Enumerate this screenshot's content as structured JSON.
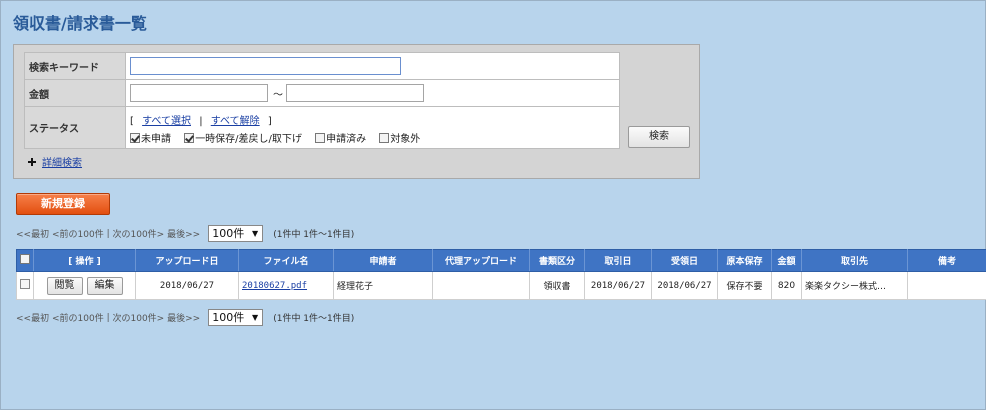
{
  "page": {
    "title": "領収書/請求書一覧"
  },
  "search": {
    "keyword_label": "検索キーワード",
    "keyword_value": "",
    "amount_label": "金額",
    "amount_from": "",
    "amount_to": "",
    "amount_separator": "～",
    "status_label": "ステータス",
    "bracket_open": "[",
    "select_all": "すべて選択",
    "link_sep": "|",
    "deselect_all": "すべて解除",
    "bracket_close": "]",
    "statuses": [
      {
        "label": "未申請",
        "checked": true
      },
      {
        "label": "一時保存/差戻し/取下げ",
        "checked": true
      },
      {
        "label": "申請済み",
        "checked": false
      },
      {
        "label": "対象外",
        "checked": false
      }
    ],
    "search_button": "検索",
    "advanced_search": "詳細検索"
  },
  "actions": {
    "new_register": "新規登録"
  },
  "pager": {
    "first": "<<最初",
    "prev": "<前の100件",
    "sep": "|",
    "next": "次の100件>",
    "last": "最後>>",
    "per_page": "100件",
    "summary": "(1件中 1件～1件目)"
  },
  "table": {
    "headers": [
      "",
      "[ 操作 ]",
      "アップロード日",
      "ファイル名",
      "申請者",
      "代理アップロード",
      "書類区分",
      "取引日",
      "受領日",
      "原本保存",
      "金額",
      "取引先",
      "備考"
    ],
    "rows": [
      {
        "view_button": "閲覧",
        "edit_button": "編集",
        "upload_date": "2018/06/27",
        "file_name": "20180627.pdf",
        "applicant": "経理花子",
        "proxy_upload": "",
        "doc_type": "領収書",
        "transaction_date": "2018/06/27",
        "received_date": "2018/06/27",
        "original_storage": "保存不要",
        "amount": "820",
        "counterparty": "楽楽タクシー株式…",
        "note": ""
      }
    ]
  },
  "colors": {
    "header_blue": "#3f74c4",
    "background": "#b8d4ec",
    "title": "#2a5b99",
    "accent_orange": "#e85a1a"
  }
}
